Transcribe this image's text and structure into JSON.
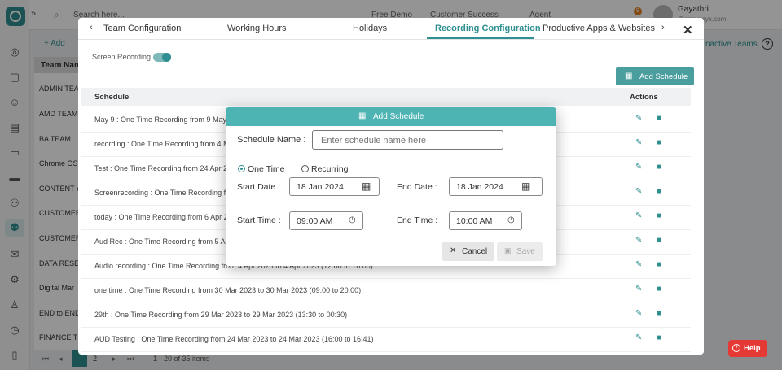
{
  "header": {
    "search_placeholder": "Search here...",
    "free_demo": "Free Demo",
    "customer_success": "Customer Success",
    "agent": "Agent",
    "notif_count": "9",
    "user_name": "Gayathri",
    "user_email": "@enovasys.com"
  },
  "background": {
    "add_label": "Add",
    "col_header": "Team Nam",
    "inactive_teams": "nactive Teams",
    "rows": [
      "ADMIN TEAM",
      "AMD TEAM",
      "BA TEAM",
      "Chrome OS",
      "CONTENT W",
      "CUSTOMER",
      "CUSTOMER",
      "DATA RESEA",
      "Digital Mar",
      "END to END",
      "FINANCE TE"
    ],
    "pagination": {
      "page": "2",
      "summary": "1 - 20 of 35 items"
    }
  },
  "panel": {
    "tabs": [
      "Team Configuration",
      "Working Hours",
      "Holidays",
      "Recording Configuration",
      "Productive Apps & Websites"
    ],
    "active_tab": "Recording Configuration",
    "screen_recording_label": "Screen Recording",
    "add_schedule_label": "Add Schedule",
    "table_headers": {
      "schedule": "Schedule",
      "actions": "Actions"
    },
    "rows": [
      "May 9 : One Time Recording from 9 May 2",
      "recording : One Time Recording from 4 M",
      "Test : One Time Recording from 24 Apr 20",
      "Screenrecording : One Time Recording fro",
      "today : One Time Recording from 6 Apr 20",
      "Aud Rec : One Time Recording from 5 Apr",
      "Audio recording : One Time Recording from 4 Apr 2023 to 4 Apr 2023 (12:00 to 16:00)",
      "one time : One Time Recording from 30 Mar 2023 to 30 Mar 2023 (09:00 to 20:00)",
      "29th : One Time Recording from 29 Mar 2023 to 29 Mar 2023 (13:30 to 00:30)",
      "AUD Testing : One Time Recording from 24 Mar 2023 to 24 Mar 2023 (16:00 to 16:41)"
    ]
  },
  "modal": {
    "title": "Add Schedule",
    "schedule_name_label": "Schedule Name :",
    "schedule_name_placeholder": "Enter schedule name here",
    "schedule_name_value": "",
    "radio_one_time": "One Time",
    "radio_recurring": "Recurring",
    "selected_type": "One Time",
    "start_date_label": "Start Date :",
    "start_date_value": "18 Jan 2024",
    "end_date_label": "End Date :",
    "end_date_value": "18 Jan 2024",
    "start_time_label": "Start Time :",
    "start_time_value": "09:00 AM",
    "end_time_label": "End Time :",
    "end_time_value": "10:00 AM",
    "cancel_label": "Cancel",
    "save_label": "Save"
  },
  "help_label": "Help",
  "colors": {
    "accent": "#2f8f91",
    "modal_header": "#4db3b3",
    "help": "#e53935"
  }
}
